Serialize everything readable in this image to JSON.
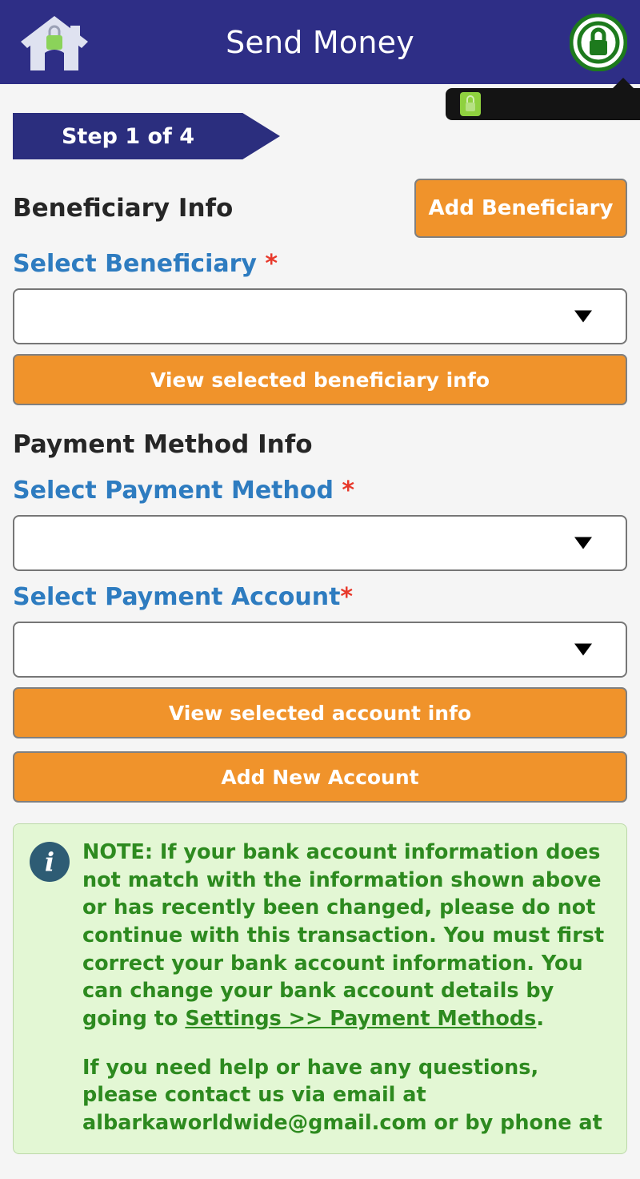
{
  "header": {
    "title": "Send Money",
    "home_icon": "home-lock-icon",
    "secure_icon": "secure-lock-circle-icon"
  },
  "tooltip": {
    "icon": "green-lock-icon",
    "text": ""
  },
  "step": {
    "label": "Step 1 of 4",
    "current": 1,
    "total": 4
  },
  "beneficiary_section": {
    "title": "Beneficiary Info",
    "add_button_label": "Add Beneficiary",
    "select_label": "Select Beneficiary",
    "required_mark": "*",
    "select_value": "",
    "view_button_label": "View selected beneficiary info"
  },
  "payment_section": {
    "title": "Payment Method Info",
    "method_label": "Select Payment Method",
    "method_required_mark": "*",
    "method_value": "",
    "account_label": "Select Payment Account",
    "account_required_mark": "*",
    "account_value": "",
    "view_account_button_label": "View selected account info",
    "add_account_button_label": "Add New Account"
  },
  "note": {
    "icon": "info-icon",
    "paragraph_1_part_1": "NOTE: If your bank account information does not match with the information shown above or has recently been changed, please do not continue with this transaction. You must first correct your bank account information. You can change your bank account details by going to ",
    "settings_link": "Settings >> Payment Methods",
    "paragraph_1_part_2": ".",
    "paragraph_2": "If you need help or have any questions, please contact us via email at albarkaworldwide@gmail.com or by phone at"
  },
  "colors": {
    "header_navy": "#2e2e86",
    "step_navy": "#2b2e7e",
    "accent_orange": "#f0932b",
    "label_blue": "#2e7cc0",
    "required_red": "#e8392b",
    "note_bg": "#e3f7d4",
    "note_text_green": "#2d8a1f",
    "page_bg": "#f5f5f5"
  }
}
